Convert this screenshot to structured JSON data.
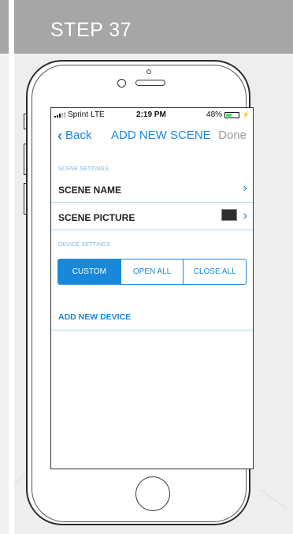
{
  "step_title": "STEP 37",
  "status_bar": {
    "carrier": "Sprint",
    "network": "LTE",
    "time": "2:19 PM",
    "battery": "48%",
    "battery_level": 0.48
  },
  "nav": {
    "back_label": "Back",
    "title": "ADD NEW SCENE",
    "done_label": "Done"
  },
  "scene_settings": {
    "header": "SCENE SETTINGS",
    "rows": [
      {
        "label": "SCENE NAME"
      },
      {
        "label": "SCENE PICTURE"
      }
    ]
  },
  "device_settings": {
    "header": "DEVICE SETTINGS",
    "segments": [
      {
        "label": "CUSTOM",
        "active": true
      },
      {
        "label": "OPEN ALL",
        "active": false
      },
      {
        "label": "CLOSE ALL",
        "active": false
      }
    ],
    "add_device_label": "ADD NEW DEVICE"
  },
  "colors": {
    "header_gray": "#a6a6a6",
    "accent_blue": "#1a88d8",
    "battery_green": "#4cd964"
  },
  "icons": [
    "chevron-left-icon",
    "chevron-right-icon",
    "signal-icon",
    "battery-icon",
    "charging-bolt-icon"
  ]
}
